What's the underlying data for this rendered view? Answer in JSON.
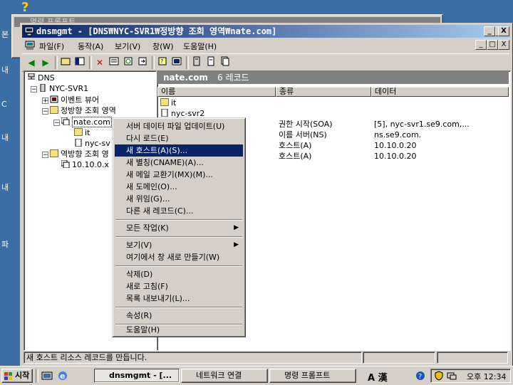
{
  "desktop": {
    "left_chars": [
      "본",
      "내",
      "C",
      "내",
      "내",
      "파"
    ]
  },
  "bg_window": {
    "title": "명령 프롬프트"
  },
  "window": {
    "title": "dnsmgmt - [DNS₩NYC-SVR1₩정방향 조회 영역₩nate.com]",
    "controls": {
      "minimize": "_",
      "maximize": "□",
      "close": "X"
    }
  },
  "menu": {
    "items": [
      "파일(F)",
      "동작(A)",
      "보기(V)",
      "창(W)",
      "도움말(H)"
    ]
  },
  "tree": {
    "root": "DNS",
    "server": "NYC-SVR1",
    "event_viewer": "이벤트 뷰어",
    "forward_zone": "정방향 조회 영역",
    "nate": "nate.com",
    "it": "it",
    "nyc": "nyc-sv",
    "reverse_zone": "역방향 조회 영",
    "rev_sub": "10.10.0.x S"
  },
  "list": {
    "header_title": "nate.com",
    "header_count": "6 레코드",
    "columns": [
      "이름",
      "종류",
      "데이터"
    ],
    "rows": [
      {
        "name": "it",
        "type": "",
        "data": ""
      },
      {
        "name": "nyc-svr2",
        "type": "",
        "data": ""
      },
      {
        "name": "",
        "type": "권한 시작(SOA)",
        "data": "[5], nyc-svr1.se9.com,..."
      },
      {
        "name": "",
        "type": "이름 서버(NS)",
        "data": "ns.se9.com."
      },
      {
        "name": "",
        "type": "호스트(A)",
        "data": "10.10.0.20"
      },
      {
        "name": "",
        "type": "호스트(A)",
        "data": "10.10.0.20"
      }
    ]
  },
  "context_menu": {
    "items": [
      {
        "label": "서버 데이터 파일 업데이트(U)"
      },
      {
        "label": "다시 로드(E)"
      },
      {
        "label": "새 호스트(A)(S)..."
      },
      {
        "label": "새 별칭(CNAME)(A)..."
      },
      {
        "label": "새 메일 교환기(MX)(M)..."
      },
      {
        "label": "새 도메인(O)..."
      },
      {
        "label": "새 위임(G)..."
      },
      {
        "label": "다른 새 레코드(C)..."
      },
      {
        "label": "모든 작업(K)"
      },
      {
        "label": "보기(V)"
      },
      {
        "label": "여기에서 창 새로 만들기(W)"
      },
      {
        "label": "삭제(D)"
      },
      {
        "label": "새로 고침(F)"
      },
      {
        "label": "목록 내보내기(L)..."
      },
      {
        "label": "속성(R)"
      },
      {
        "label": "도움말(H)"
      }
    ]
  },
  "status": {
    "text": "새 호스트 리소스 레코드를 만듭니다."
  },
  "taskbar": {
    "start": "시작",
    "tasks": [
      "dnsmgmt - [...",
      "네트워크 연결",
      "명령 프롬프트"
    ],
    "ime": "A 漢",
    "clock": "오후 12:34"
  },
  "colors": {
    "title_start": "#0a246a",
    "title_end": "#a6caf0",
    "face": "#d4d0c8",
    "desktop": "#3a6ea5",
    "highlight": "#0a246a"
  }
}
